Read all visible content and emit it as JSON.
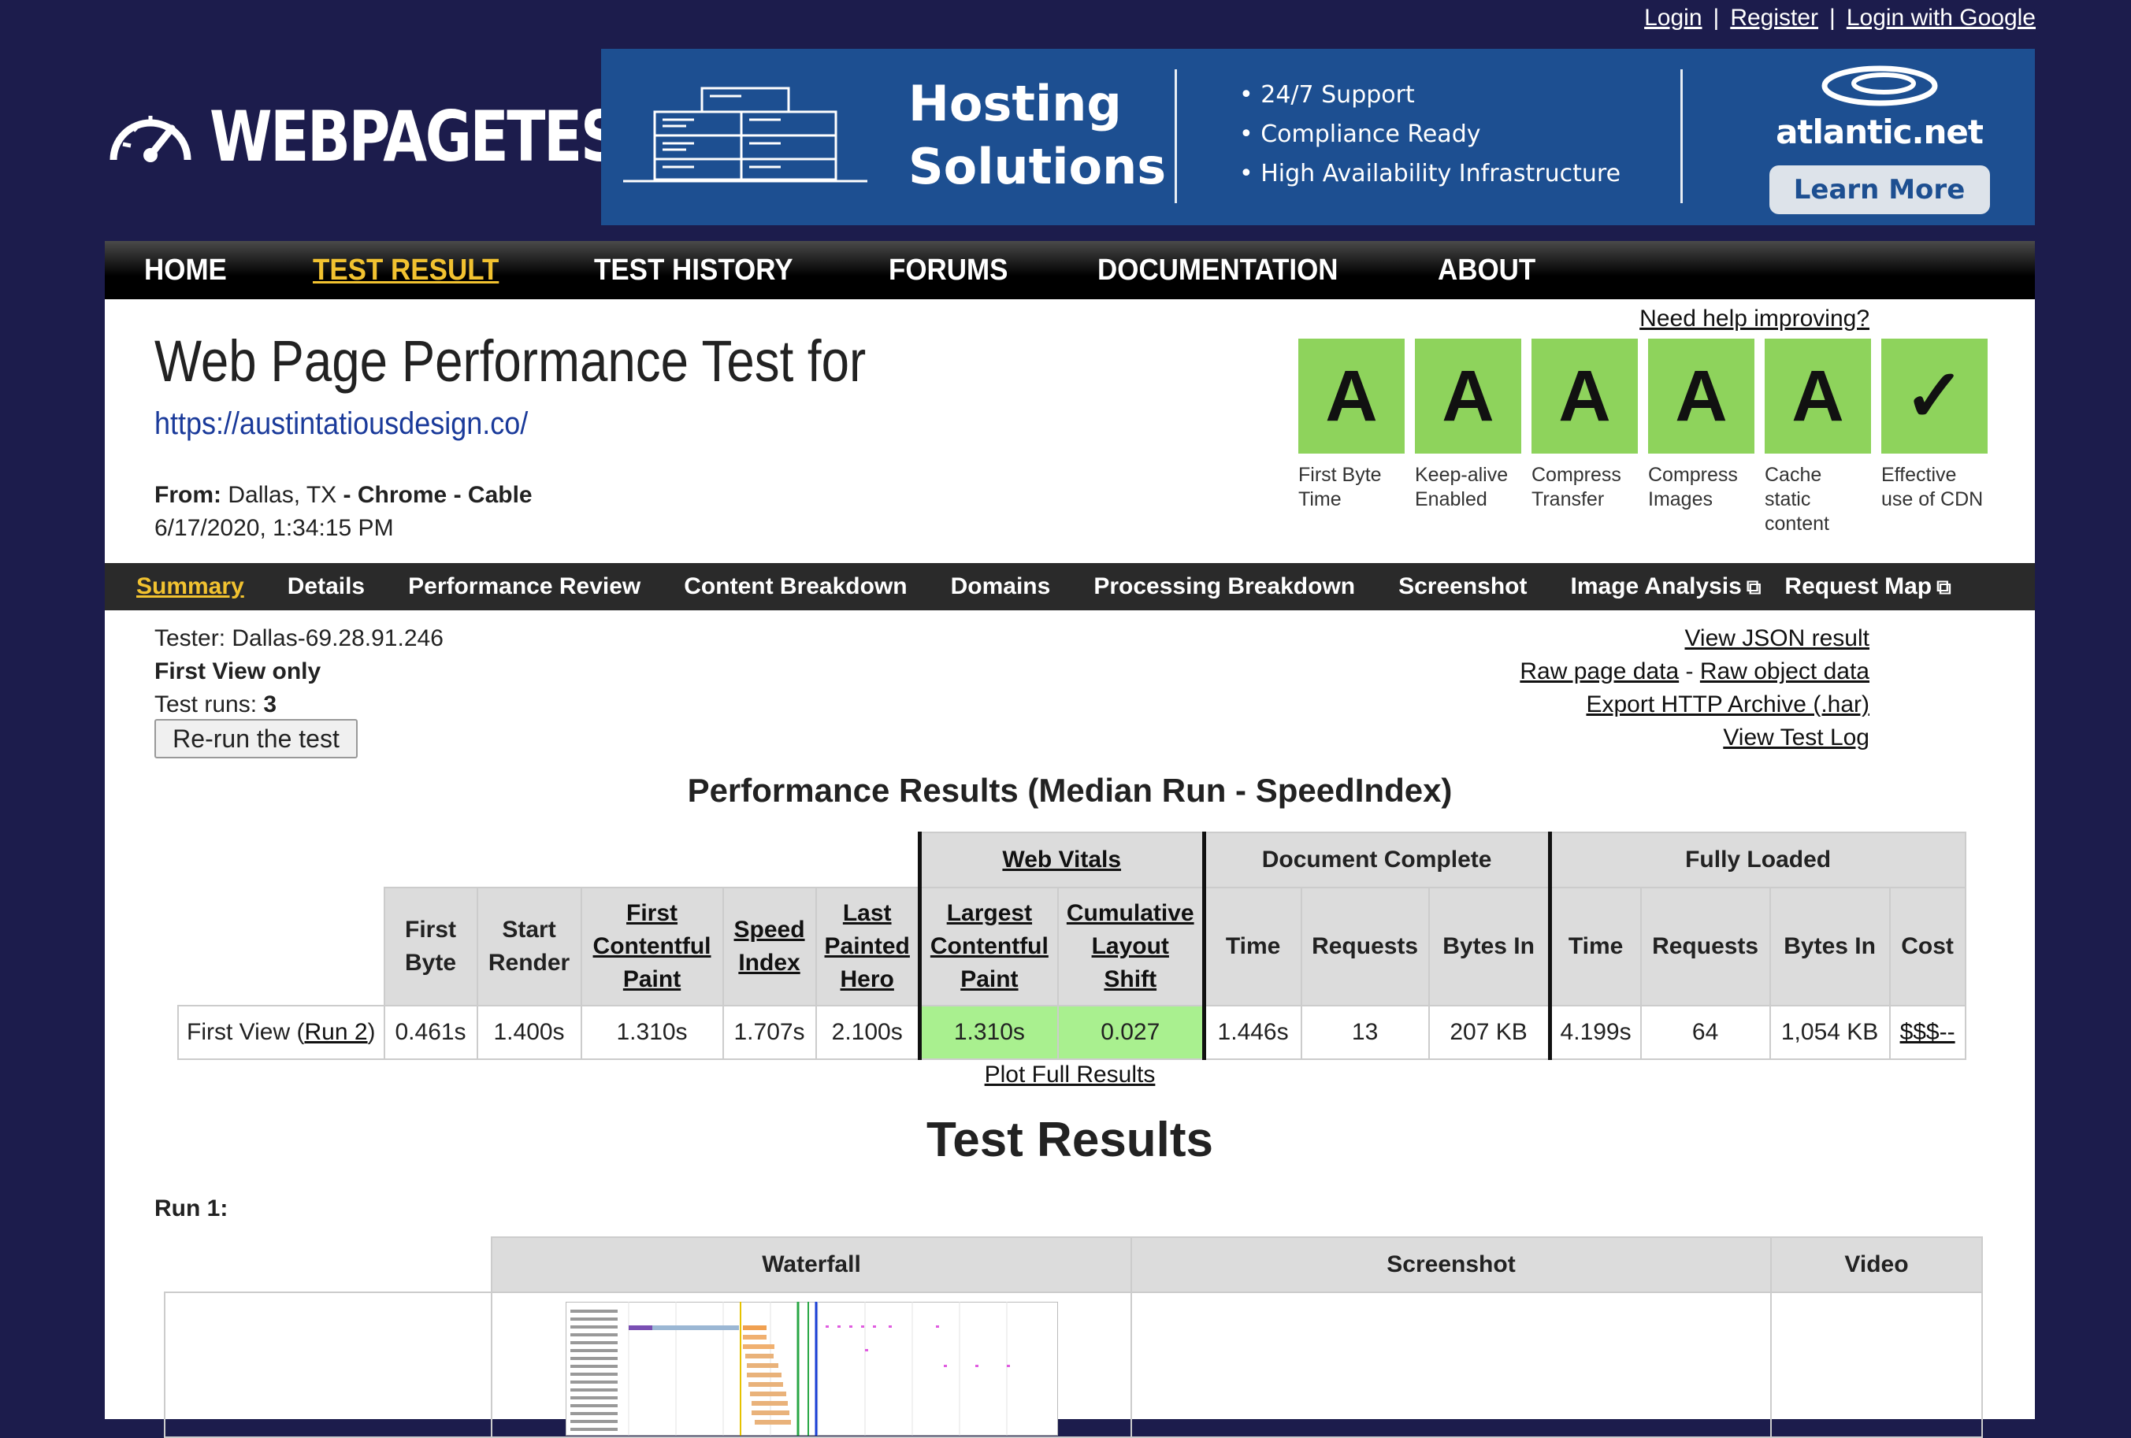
{
  "auth": {
    "login": "Login",
    "register": "Register",
    "google": "Login with Google",
    "sep": "|"
  },
  "logo": {
    "text": "WEBPAGETEST",
    "icon": "speedometer-icon"
  },
  "ad": {
    "headline_1": "Hosting",
    "headline_2": "Solutions",
    "bullets": [
      "• 24/7 Support",
      "• Compliance Ready",
      "• High Availability Infrastructure"
    ],
    "brand": "atlantic.net",
    "cta": "Learn More",
    "bg_color": "#1d4f91"
  },
  "nav": {
    "items": [
      "HOME",
      "TEST RESULT",
      "TEST HISTORY",
      "FORUMS",
      "DOCUMENTATION",
      "ABOUT"
    ],
    "active": "TEST RESULT",
    "accent": "#f2c230"
  },
  "header": {
    "title": "Web Page Performance Test for",
    "url": "https://austintatiousdesign.co/",
    "from_label": "From:",
    "from_location": "Dallas, TX",
    "dash": "-",
    "browser": "Chrome",
    "connection": "Cable",
    "date": "6/17/2020, 1:34:15 PM",
    "help": "Need help improving?"
  },
  "grades": [
    {
      "grade": "A",
      "label": "First Byte Time"
    },
    {
      "grade": "A",
      "label": "Keep-alive Enabled"
    },
    {
      "grade": "A",
      "label": "Compress Transfer"
    },
    {
      "grade": "A",
      "label": "Compress Images"
    },
    {
      "grade": "A",
      "label": "Cache static content"
    },
    {
      "grade": "✓",
      "label": "Effective use of CDN"
    }
  ],
  "grade_color": "#8ed35c",
  "subnav": {
    "items": [
      "Summary",
      "Details",
      "Performance Review",
      "Content Breakdown",
      "Domains",
      "Processing Breakdown",
      "Screenshot",
      "Image Analysis",
      "Request Map"
    ],
    "active": "Summary"
  },
  "test_info": {
    "tester": "Tester: Dallas-69.28.91.246",
    "view": "First View only",
    "runs_label": "Test runs:",
    "runs": "3",
    "rerun": "Re-run the test"
  },
  "links": {
    "json": "View JSON result",
    "raw_page": "Raw page data",
    "raw_sep": "-",
    "raw_object": "Raw object data",
    "har": "Export HTTP Archive (.har)",
    "log": "View Test Log"
  },
  "perf": {
    "title": "Performance Results (Median Run - SpeedIndex)",
    "group_vitals": "Web Vitals",
    "group_doc": "Document Complete",
    "group_full": "Fully Loaded",
    "columns": {
      "first_byte": "First Byte",
      "start_render": "Start Render",
      "fcp": "First Contentful Paint",
      "speed_index": "Speed Index",
      "lph": "Last Painted Hero",
      "lcp": "Largest Contentful Paint",
      "cls": "Cumulative Layout Shift",
      "doc_time": "Time",
      "doc_requests": "Requests",
      "doc_bytes": "Bytes In",
      "full_time": "Time",
      "full_requests": "Requests",
      "full_bytes": "Bytes In",
      "cost": "Cost"
    },
    "row": {
      "label_pre": "First View (",
      "run_link": "Run 2",
      "label_post": ")",
      "first_byte": "0.461s",
      "start_render": "1.400s",
      "fcp": "1.310s",
      "speed_index": "1.707s",
      "lph": "2.100s",
      "lcp": "1.310s",
      "cls": "0.027",
      "doc_time": "1.446s",
      "doc_requests": "13",
      "doc_bytes": "207 KB",
      "full_time": "4.199s",
      "full_requests": "64",
      "full_bytes": "1,054 KB",
      "cost": "$$$--"
    },
    "plot_link": "Plot Full Results",
    "vital_color": "#a9f08f"
  },
  "results": {
    "title": "Test Results",
    "run_label": "Run 1:",
    "col_waterfall": "Waterfall",
    "col_screenshot": "Screenshot",
    "col_video": "Video"
  }
}
